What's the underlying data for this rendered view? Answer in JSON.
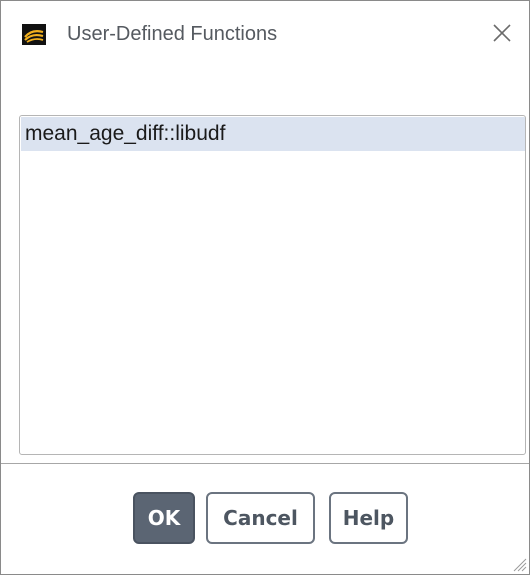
{
  "window": {
    "title": "User-Defined Functions",
    "app_icon": "fluent-app-icon",
    "close_icon": "close-icon"
  },
  "list": {
    "items": [
      {
        "label": "mean_age_diff::libudf",
        "selected": true
      }
    ]
  },
  "buttons": {
    "ok_label": "OK",
    "cancel_label": "Cancel",
    "help_label": "Help"
  },
  "colors": {
    "selection": "#dbe3f0",
    "primary_button": "#5b6573",
    "button_border": "#6b7480"
  }
}
